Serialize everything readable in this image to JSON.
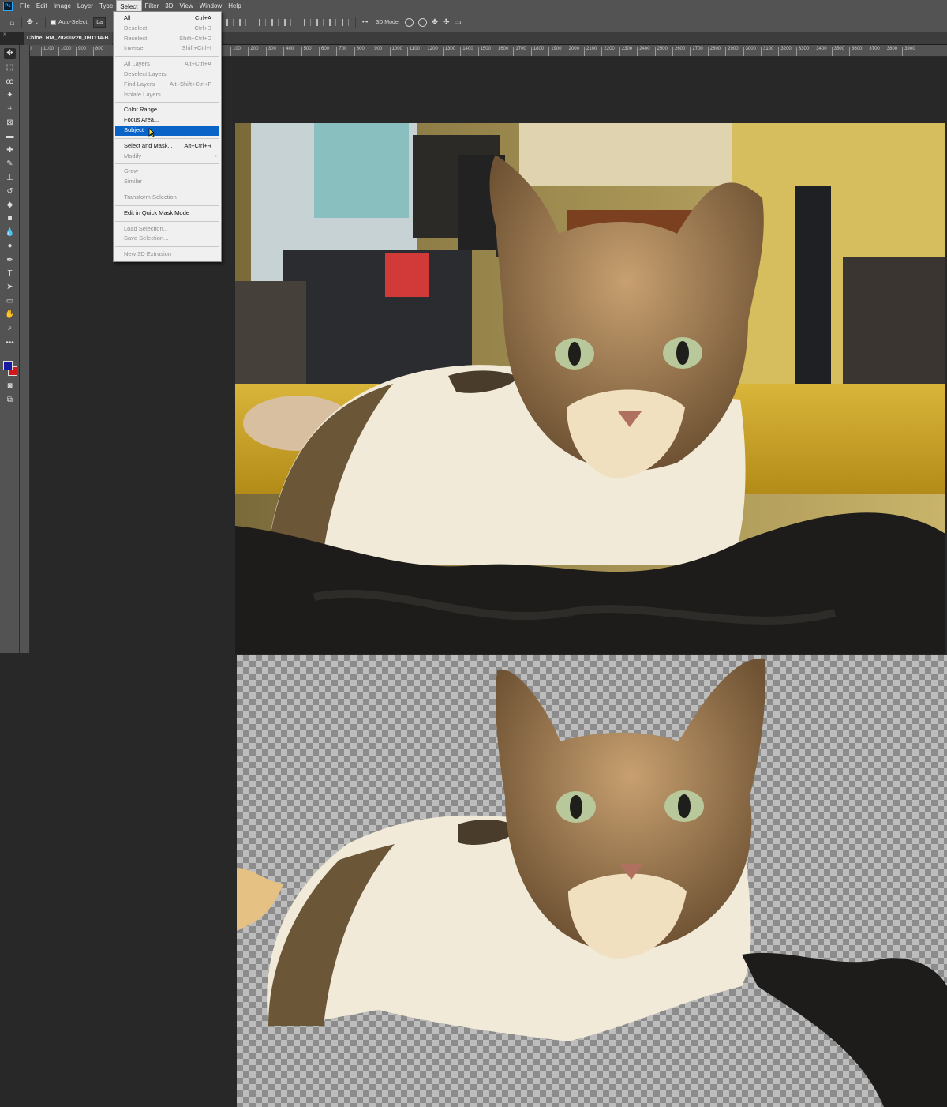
{
  "menubar": {
    "logo": "Ps",
    "items": [
      "File",
      "Edit",
      "Image",
      "Layer",
      "Type",
      "Select",
      "Filter",
      "3D",
      "View",
      "Window",
      "Help"
    ],
    "active_index": 5
  },
  "options_bar": {
    "auto_select_label": "Auto-Select:",
    "layer_dropdown": "La",
    "mode_3d_label": "3D Mode:",
    "more_label": "•••"
  },
  "document": {
    "tab_title": "ChloeLRM_20200220_091114-B"
  },
  "ruler": {
    "h_labels_left": [
      "00",
      "1100",
      "1000",
      "900",
      "800"
    ],
    "h_labels_right": [
      "100",
      "200",
      "300",
      "400",
      "500",
      "600",
      "700",
      "800",
      "900",
      "1000",
      "1100",
      "1200",
      "1300",
      "1400",
      "1500",
      "1600",
      "1700",
      "1800",
      "1900",
      "2000",
      "2100",
      "2200",
      "2300",
      "2400",
      "2500",
      "2600",
      "2700",
      "2800",
      "2900",
      "3000",
      "3100",
      "3200",
      "3300",
      "3400",
      "3500",
      "3600",
      "3700",
      "3800",
      "3900"
    ]
  },
  "select_menu": {
    "items": [
      {
        "label": "All",
        "shortcut": "Ctrl+A",
        "disabled": false
      },
      {
        "label": "Deselect",
        "shortcut": "Ctrl+D",
        "disabled": true
      },
      {
        "label": "Reselect",
        "shortcut": "Shift+Ctrl+D",
        "disabled": true
      },
      {
        "label": "Inverse",
        "shortcut": "Shift+Ctrl+I",
        "disabled": true
      },
      {
        "label": "All Layers",
        "shortcut": "Alt+Ctrl+A",
        "disabled": true
      },
      {
        "label": "Deselect Layers",
        "shortcut": "",
        "disabled": true
      },
      {
        "label": "Find Layers",
        "shortcut": "Alt+Shift+Ctrl+F",
        "disabled": true
      },
      {
        "label": "Isolate Layers",
        "shortcut": "",
        "disabled": true
      },
      {
        "label": "Color Range...",
        "shortcut": "",
        "disabled": false
      },
      {
        "label": "Focus Area...",
        "shortcut": "",
        "disabled": false
      },
      {
        "label": "Subject",
        "shortcut": "",
        "disabled": false,
        "highlighted": true
      },
      {
        "label": "Select and Mask...",
        "shortcut": "Alt+Ctrl+R",
        "disabled": false
      },
      {
        "label": "Modify",
        "shortcut": "",
        "disabled": true,
        "submenu": true
      },
      {
        "label": "Grow",
        "shortcut": "",
        "disabled": true
      },
      {
        "label": "Similar",
        "shortcut": "",
        "disabled": true
      },
      {
        "label": "Transform Selection",
        "shortcut": "",
        "disabled": true
      },
      {
        "label": "Edit in Quick Mask Mode",
        "shortcut": "",
        "disabled": false
      },
      {
        "label": "Load Selection...",
        "shortcut": "",
        "disabled": true
      },
      {
        "label": "Save Selection...",
        "shortcut": "",
        "disabled": true
      },
      {
        "label": "New 3D Extrusion",
        "shortcut": "",
        "disabled": true
      }
    ]
  },
  "colors": {
    "foreground": "#1a1aa0",
    "background": "#d21818",
    "menu_highlight": "#0a64c8"
  }
}
